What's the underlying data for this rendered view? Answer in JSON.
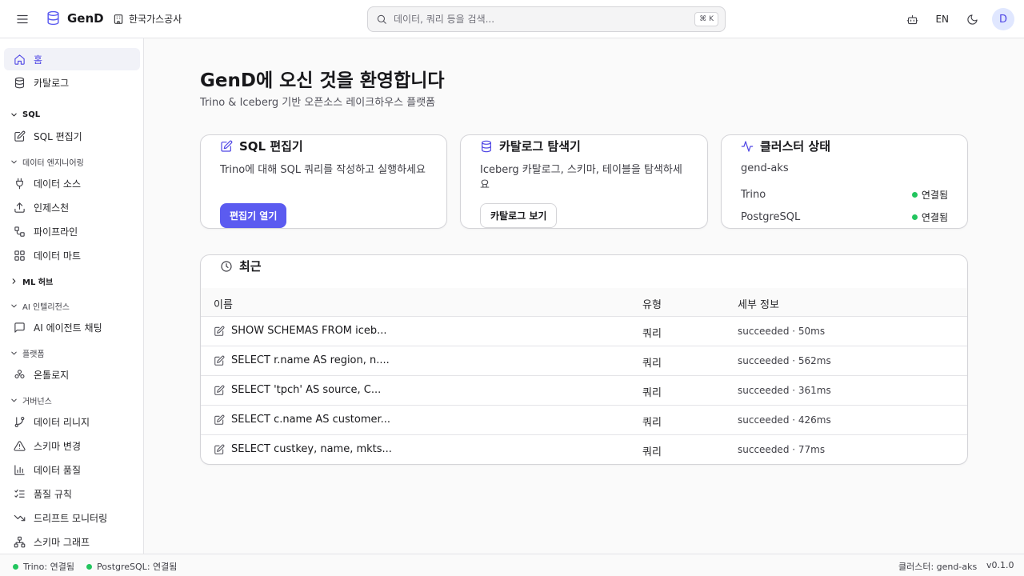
{
  "header": {
    "app_name": "GenD",
    "org_name": "한국가스공사",
    "search": {
      "placeholder": "데이터, 쿼리 등을 검색...",
      "shortcut": "⌘ K"
    },
    "language": "EN",
    "avatar_initial": "D",
    "accent_color": "#5b5bf0"
  },
  "sidebar": {
    "items": {
      "home": "홈",
      "catalog": "카탈로그",
      "sql_editor": "SQL 편집기",
      "data_sources": "데이터 소스",
      "ingestion": "인제스천",
      "pipeline": "파이프라인",
      "data_mart": "데이터 마트",
      "ai_chat": "AI 에이전트 채팅",
      "ontology": "온톨로지",
      "lineage": "데이터 리니지",
      "schema_change": "스키마 변경",
      "data_quality": "데이터 품질",
      "quality_rules": "품질 규칙",
      "drift_monitoring": "드리프트 모니터링",
      "schema_graph": "스키마 그래프"
    },
    "groups": {
      "sql": "SQL",
      "data_engineering": "데이터 엔지니어링",
      "ml_hub": "ML 허브",
      "ai_intelligence": "AI 인텔리전스",
      "platform": "플랫폼",
      "governance": "거버넌스"
    }
  },
  "main": {
    "title": "GenD에 오신 것을 환영합니다",
    "subtitle": "Trino & Iceberg 기반 오픈소스 레이크하우스 플랫폼",
    "cards": {
      "sql": {
        "title": "SQL 편집기",
        "description": "Trino에 대해 SQL 쿼리를 작성하고 실행하세요",
        "button": "편집기 열기"
      },
      "catalog": {
        "title": "카탈로그 탐색기",
        "description": "Iceberg 카탈로그, 스키마, 테이블을 탐색하세요",
        "button": "카탈로그 보기"
      },
      "cluster": {
        "title": "클러스터 상태",
        "name": "gend-aks",
        "statuses": [
          {
            "service": "Trino",
            "state": "연결됨"
          },
          {
            "service": "PostgreSQL",
            "state": "연결됨"
          }
        ]
      }
    },
    "recent": {
      "title": "최근",
      "columns": {
        "name": "이름",
        "type": "유형",
        "detail": "세부 정보"
      },
      "rows": [
        {
          "name": "SHOW SCHEMAS FROM iceb...",
          "type": "쿼리",
          "detail": "succeeded · 50ms"
        },
        {
          "name": "SELECT r.name AS region, n....",
          "type": "쿼리",
          "detail": "succeeded · 562ms"
        },
        {
          "name": "SELECT 'tpch' AS source, C...",
          "type": "쿼리",
          "detail": "succeeded · 361ms"
        },
        {
          "name": "SELECT c.name AS customer...",
          "type": "쿼리",
          "detail": "succeeded · 426ms"
        },
        {
          "name": "SELECT custkey, name, mkts...",
          "type": "쿼리",
          "detail": "succeeded · 77ms"
        }
      ]
    }
  },
  "footer": {
    "trino_status": "Trino: 연결됨",
    "postgres_status": "PostgreSQL: 연결됨",
    "cluster": "클러스터: gend-aks",
    "version": "v0.1.0",
    "status_color": "#22c55e"
  }
}
